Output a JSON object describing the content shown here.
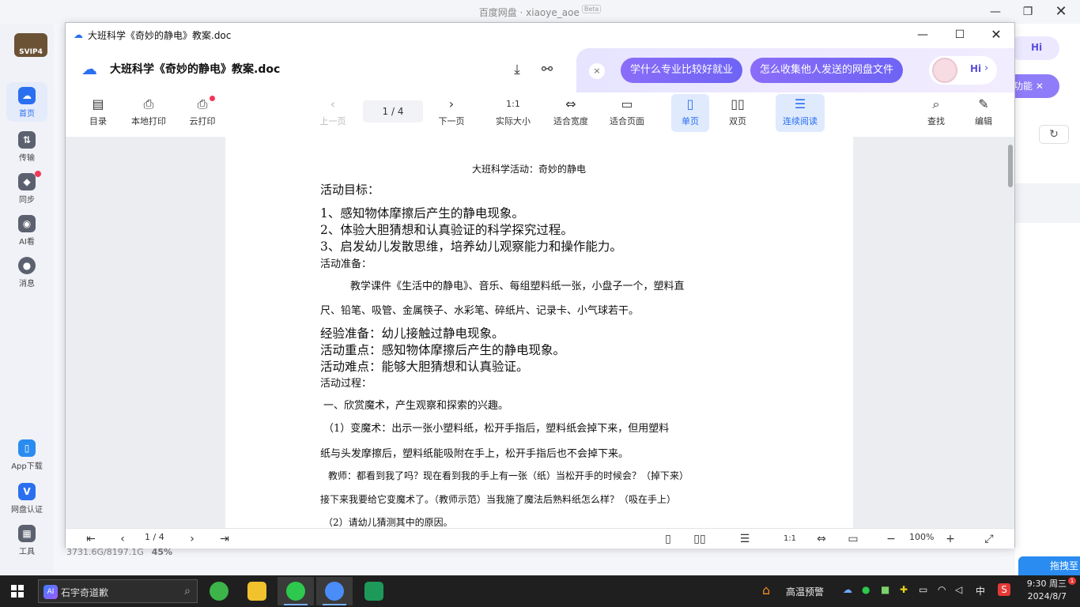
{
  "background_app": {
    "title": "百度网盘 · xiaoye_aoe",
    "beta": "Beta",
    "logo": "SVIP4",
    "sidebar": [
      {
        "label": "首页",
        "icon": "cloud-icon"
      },
      {
        "label": "传输",
        "icon": "transfer-icon"
      },
      {
        "label": "同步",
        "icon": "sync-icon"
      },
      {
        "label": "AI看",
        "icon": "ai-icon"
      },
      {
        "label": "消息",
        "icon": "message-icon"
      },
      {
        "label": "App下载",
        "icon": "phone-icon"
      },
      {
        "label": "网盘认证",
        "icon": "verify-icon"
      },
      {
        "label": "工具",
        "icon": "tools-icon"
      }
    ],
    "storage": "3731.6G/8197.1G",
    "storage_percent": "45%",
    "right_partial_hi": "Hi",
    "right_partial_feature": "功能",
    "right_partial_bottom": "拖拽至"
  },
  "viewer": {
    "window_title": "大班科学《奇妙的静电》教案.doc",
    "doc_title": "大班科学《奇妙的静电》教案.doc",
    "promo": {
      "close": "×",
      "pill1": "学什么专业比较好就业",
      "pill2": "怎么收集他人发送的网盘文件",
      "hi": "Hi"
    },
    "toolbar": {
      "toc": "目录",
      "local_print": "本地打印",
      "cloud_print": "云打印",
      "prev": "上一页",
      "page": "1 / 4",
      "next": "下一页",
      "actual_size": "实际大小",
      "fit_width": "适合宽度",
      "fit_page": "适合页面",
      "single": "单页",
      "double": "双页",
      "continuous": "连续阅读",
      "find": "查找",
      "edit": "编辑"
    },
    "document": {
      "title": "大班科学活动：奇妙的静电",
      "lines": [
        "活动目标：",
        "1、感知物体摩擦后产生的静电现象。",
        "2、体验大胆猜想和认真验证的科学探究过程。",
        "3、启发幼儿发散思维，培养幼儿观察能力和操作能力。",
        "活动准备：",
        "教学课件《生活中的静电》、音乐、每组塑料纸一张，小盘子一个，塑料直",
        "尺、铅笔、吸管、金属筷子、水彩笔、碎纸片、记录卡、小气球若干。",
        "经验准备：幼儿接触过静电现象。",
        "活动重点：感知物体摩擦后产生的静电现象。",
        "活动难点：能够大胆猜想和认真验证。",
        "活动过程：",
        "一、欣赏魔术，产生观察和探索的兴趣。",
        "（1）变魔术：出示一张小塑料纸，松开手指后，塑料纸会掉下来，但用塑料",
        "纸与头发摩擦后，塑料纸能吸附在手上，松开手指后也不会掉下来。",
        "教师：都看到我了吗？现在看到我的手上有一张（纸）当松开手的时候会？（掉下来）",
        "接下来我要给它变魔术了。（教师示范）当我施了魔法后熟料纸怎么样？（吸在手上）",
        "（2）请幼儿猜测其中的原因。"
      ]
    },
    "bottom": {
      "page": "1 / 4",
      "zoom": "100%"
    }
  },
  "taskbar": {
    "search_text": "石宇奇道歉",
    "ai_badge": "AI",
    "weather_alert": "高温预警",
    "ime": "中",
    "time": "9:30 周三",
    "date": "2024/8/7",
    "notification_count": "1"
  }
}
